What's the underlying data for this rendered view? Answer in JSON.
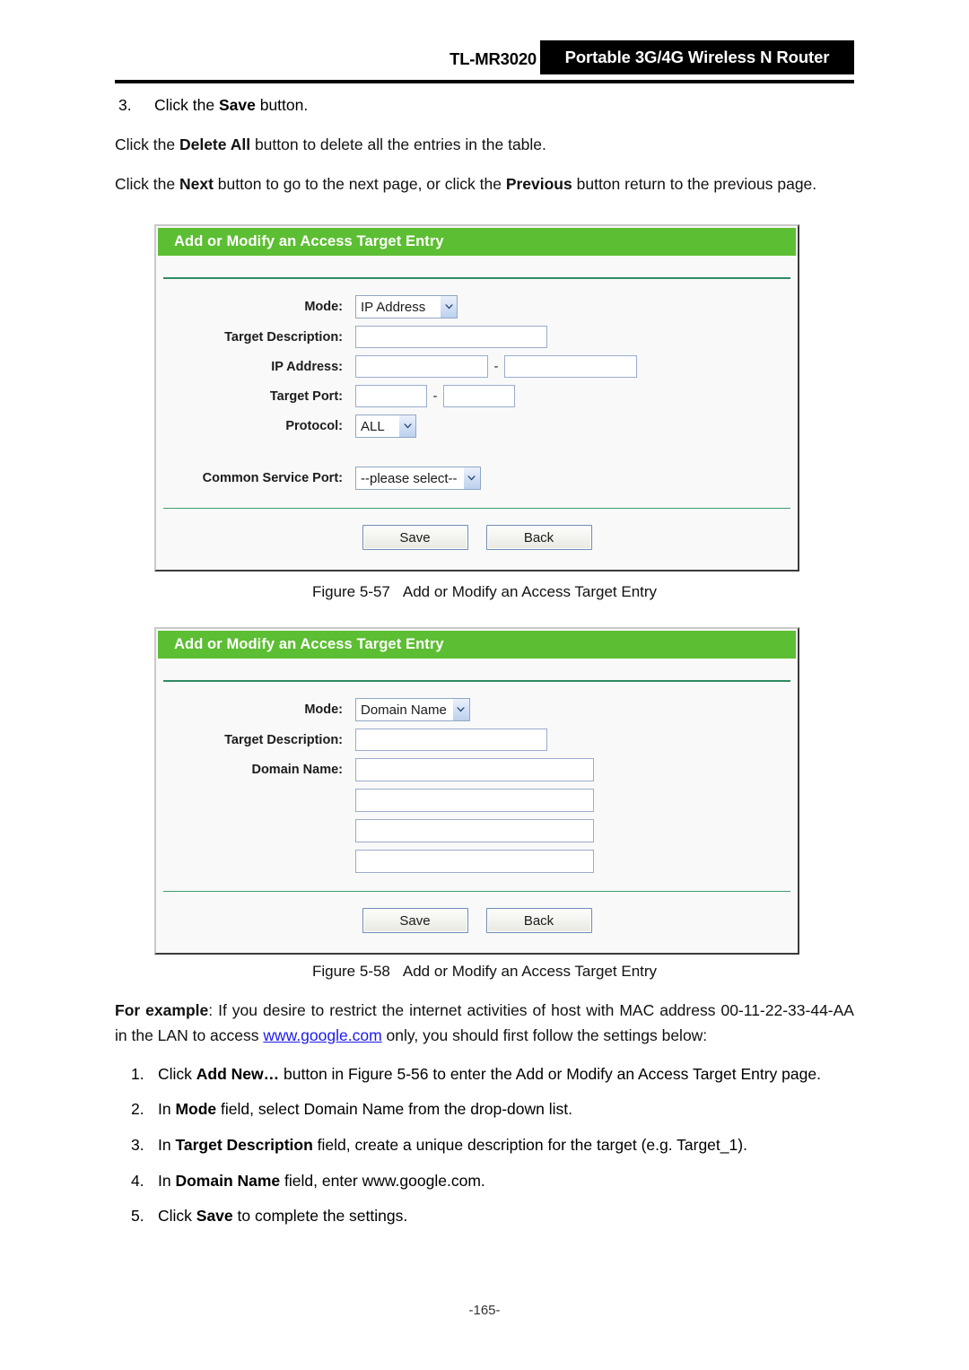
{
  "header": {
    "model": "TL-MR3020",
    "product": "Portable 3G/4G Wireless N Router"
  },
  "intro": {
    "step3_num": "3.",
    "step3_pre": "Click the ",
    "step3_bold": "Save",
    "step3_post": " button.",
    "delete_all_pre": "Click the ",
    "delete_all_bold": "Delete All",
    "delete_all_post": " button to delete all the entries in the table.",
    "nav_pre": "Click the ",
    "nav_bold1": "Next",
    "nav_mid": " button to go to the next page, or click the ",
    "nav_bold2": "Previous",
    "nav_post": " button return to the previous page."
  },
  "panel1": {
    "title": "Add or Modify an Access Target Entry",
    "labels": {
      "mode": "Mode:",
      "target_description": "Target Description:",
      "ip_address": "IP Address:",
      "target_port": "Target Port:",
      "protocol": "Protocol:",
      "common_service_port": "Common Service Port:"
    },
    "values": {
      "mode": "IP Address",
      "target_description": "",
      "ip_start": "",
      "ip_end": "",
      "port_start": "",
      "port_end": "",
      "protocol": "ALL",
      "common_service_port": "--please select--"
    },
    "separator": "-",
    "buttons": {
      "save": "Save",
      "back": "Back"
    }
  },
  "caption1": {
    "figure": "Figure 5-57",
    "text": "Add or Modify an Access Target Entry"
  },
  "panel2": {
    "title": "Add or Modify an Access Target Entry",
    "labels": {
      "mode": "Mode:",
      "target_description": "Target Description:",
      "domain_name": "Domain Name:"
    },
    "values": {
      "mode": "Domain Name",
      "target_description": "",
      "domain_name_1": "",
      "domain_name_2": "",
      "domain_name_3": "",
      "domain_name_4": ""
    },
    "buttons": {
      "save": "Save",
      "back": "Back"
    }
  },
  "caption2": {
    "figure": "Figure 5-58",
    "text": "Add or Modify an Access Target Entry"
  },
  "example": {
    "lead": "For example",
    "part1": ": If you desire to restrict the internet activities of host with MAC address 00-11-22-33-44-AA in the LAN to access ",
    "link": "www.google.com",
    "part2": " only, you should first follow the settings below:"
  },
  "steps": [
    {
      "num": "1.",
      "pre": "Click ",
      "bold": "Add New…",
      "post": " button in Figure 5-56 to enter the Add or Modify an Access Target Entry page."
    },
    {
      "num": "2.",
      "pre": "In ",
      "bold": "Mode",
      "post": " field, select Domain Name from the drop-down list."
    },
    {
      "num": "3.",
      "pre": "In ",
      "bold": "Target Description",
      "post": " field, create a unique description for the target (e.g. Target_1)."
    },
    {
      "num": "4.",
      "pre": "In ",
      "bold": "Domain Name",
      "post": " field, enter www.google.com."
    },
    {
      "num": "5.",
      "pre": "Click ",
      "bold": "Save",
      "post": " to complete the settings."
    }
  ],
  "footer": {
    "page_number": "-165-"
  },
  "colors": {
    "panel_title_green": "#5cbe32",
    "divider_green": "#2e8b62",
    "link_blue": "#1a1aee",
    "header_black": "#000000"
  }
}
